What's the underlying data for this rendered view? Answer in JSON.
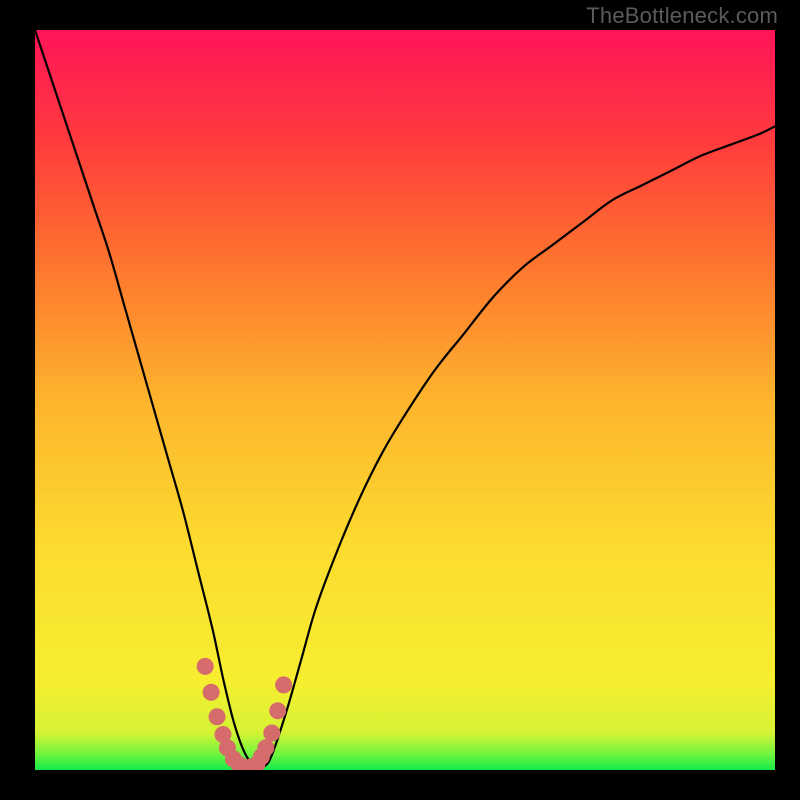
{
  "credit": {
    "text": "TheBottleneck.com",
    "top": 3,
    "right": 22
  },
  "colors": {
    "green": "#12ea49",
    "yellow": "#fcee30",
    "orange": "#fd8b2d",
    "red": "#ff1345",
    "pink": "#ff1d59",
    "curve": "#000000",
    "marker": "#d66b6c",
    "frame": "#000000"
  },
  "chart_data": {
    "type": "line",
    "title": "",
    "xlabel": "",
    "ylabel": "",
    "xlim": [
      0,
      100
    ],
    "ylim": [
      0,
      100
    ],
    "grid": false,
    "legend": false,
    "series": [
      {
        "name": "curve",
        "x": [
          0,
          2,
          4,
          6,
          8,
          10,
          12,
          14,
          16,
          18,
          20,
          22,
          24,
          25.5,
          27,
          28.5,
          30,
          31,
          32,
          34,
          36,
          38,
          41,
          44,
          47,
          50,
          54,
          58,
          62,
          66,
          70,
          74,
          78,
          82,
          86,
          90,
          94,
          98,
          100
        ],
        "y": [
          100,
          94,
          88,
          82,
          76,
          70,
          63,
          56,
          49,
          42,
          35,
          27,
          19,
          12,
          6,
          2,
          0.3,
          0.5,
          2,
          8,
          15,
          22,
          30,
          37,
          43,
          48,
          54,
          59,
          64,
          68,
          71,
          74,
          77,
          79,
          81,
          83,
          84.5,
          86,
          87
        ]
      }
    ],
    "markers": {
      "name": "bottom-cluster",
      "x": [
        23.0,
        23.8,
        24.6,
        25.4,
        26.0,
        26.8,
        27.6,
        28.4,
        29.2,
        30.0,
        30.6,
        31.2,
        32.0,
        32.8,
        33.6
      ],
      "y": [
        14.0,
        10.5,
        7.2,
        4.8,
        3.0,
        1.5,
        0.7,
        0.3,
        0.4,
        0.8,
        1.8,
        3.0,
        5.0,
        8.0,
        11.5
      ]
    },
    "gradient_stops": [
      {
        "pct": 0,
        "color": "#12ea49"
      },
      {
        "pct": 2,
        "color": "#6bf53e"
      },
      {
        "pct": 5,
        "color": "#d5f334"
      },
      {
        "pct": 12,
        "color": "#f7ee30"
      },
      {
        "pct": 30,
        "color": "#fcdc2f"
      },
      {
        "pct": 50,
        "color": "#fdb42d"
      },
      {
        "pct": 70,
        "color": "#fe6f2f"
      },
      {
        "pct": 85,
        "color": "#ff3b3d"
      },
      {
        "pct": 100,
        "color": "#ff1459"
      }
    ]
  }
}
